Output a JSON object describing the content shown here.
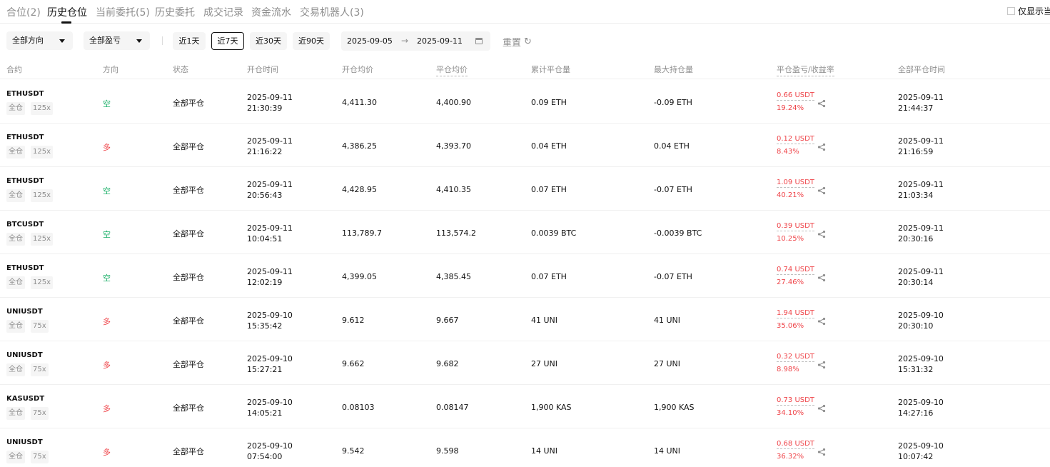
{
  "tabs": [
    {
      "label": "合位(2)"
    },
    {
      "label": "历史仓位"
    },
    {
      "label": "当前委托(5)"
    },
    {
      "label": "历史委托"
    },
    {
      "label": "成交记录"
    },
    {
      "label": "资金流水"
    },
    {
      "label": "交易机器人(3)"
    }
  ],
  "active_tab": 1,
  "only_show_label": "仅显示当",
  "filters": {
    "direction": "全部方向",
    "pnl": "全部盈亏",
    "ranges": [
      "近1天",
      "近7天",
      "近30天",
      "近90天"
    ],
    "active_range": 1,
    "date_from": "2025-09-05",
    "date_to": "2025-09-11",
    "reset_label": "重置"
  },
  "columns": [
    "合约",
    "方向",
    "状态",
    "开仓时间",
    "开仓均价",
    "平仓均价",
    "累计平仓量",
    "最大持仓量",
    "平仓盈亏/收益率",
    "全部平仓时间"
  ],
  "rows": [
    {
      "symbol": "ETHUSDT",
      "margin": "全仓",
      "leverage": "125x",
      "direction": "空",
      "dir_type": "short",
      "status": "全部平仓",
      "open_date": "2025-09-11",
      "open_clock": "21:30:39",
      "open_price": "4,411.30",
      "close_price": "4,400.90",
      "closed_qty": "0.09 ETH",
      "max_qty": "-0.09 ETH",
      "pnl": "0.66 USDT",
      "rate": "19.24%",
      "close_date": "2025-09-11",
      "close_clock": "21:44:37"
    },
    {
      "symbol": "ETHUSDT",
      "margin": "全仓",
      "leverage": "125x",
      "direction": "多",
      "dir_type": "long",
      "status": "全部平仓",
      "open_date": "2025-09-11",
      "open_clock": "21:16:22",
      "open_price": "4,386.25",
      "close_price": "4,393.70",
      "closed_qty": "0.04 ETH",
      "max_qty": "0.04 ETH",
      "pnl": "0.12 USDT",
      "rate": "8.43%",
      "close_date": "2025-09-11",
      "close_clock": "21:16:59"
    },
    {
      "symbol": "ETHUSDT",
      "margin": "全仓",
      "leverage": "125x",
      "direction": "空",
      "dir_type": "short",
      "status": "全部平仓",
      "open_date": "2025-09-11",
      "open_clock": "20:56:43",
      "open_price": "4,428.95",
      "close_price": "4,410.35",
      "closed_qty": "0.07 ETH",
      "max_qty": "-0.07 ETH",
      "pnl": "1.09 USDT",
      "rate": "40.21%",
      "close_date": "2025-09-11",
      "close_clock": "21:03:34"
    },
    {
      "symbol": "BTCUSDT",
      "margin": "全仓",
      "leverage": "125x",
      "direction": "空",
      "dir_type": "short",
      "status": "全部平仓",
      "open_date": "2025-09-11",
      "open_clock": "10:04:51",
      "open_price": "113,789.7",
      "close_price": "113,574.2",
      "closed_qty": "0.0039 BTC",
      "max_qty": "-0.0039 BTC",
      "pnl": "0.39 USDT",
      "rate": "10.25%",
      "close_date": "2025-09-11",
      "close_clock": "20:30:16"
    },
    {
      "symbol": "ETHUSDT",
      "margin": "全仓",
      "leverage": "125x",
      "direction": "空",
      "dir_type": "short",
      "status": "全部平仓",
      "open_date": "2025-09-11",
      "open_clock": "12:02:19",
      "open_price": "4,399.05",
      "close_price": "4,385.45",
      "closed_qty": "0.07 ETH",
      "max_qty": "-0.07 ETH",
      "pnl": "0.74 USDT",
      "rate": "27.46%",
      "close_date": "2025-09-11",
      "close_clock": "20:30:14"
    },
    {
      "symbol": "UNIUSDT",
      "margin": "全仓",
      "leverage": "75x",
      "direction": "多",
      "dir_type": "long",
      "status": "全部平仓",
      "open_date": "2025-09-10",
      "open_clock": "15:35:42",
      "open_price": "9.612",
      "close_price": "9.667",
      "closed_qty": "41 UNI",
      "max_qty": "41 UNI",
      "pnl": "1.94 USDT",
      "rate": "35.06%",
      "close_date": "2025-09-10",
      "close_clock": "20:30:10"
    },
    {
      "symbol": "UNIUSDT",
      "margin": "全仓",
      "leverage": "75x",
      "direction": "多",
      "dir_type": "long",
      "status": "全部平仓",
      "open_date": "2025-09-10",
      "open_clock": "15:27:21",
      "open_price": "9.662",
      "close_price": "9.682",
      "closed_qty": "27 UNI",
      "max_qty": "27 UNI",
      "pnl": "0.32 USDT",
      "rate": "8.98%",
      "close_date": "2025-09-10",
      "close_clock": "15:31:32"
    },
    {
      "symbol": "KASUSDT",
      "margin": "全仓",
      "leverage": "75x",
      "direction": "多",
      "dir_type": "long",
      "status": "全部平仓",
      "open_date": "2025-09-10",
      "open_clock": "14:05:21",
      "open_price": "0.08103",
      "close_price": "0.08147",
      "closed_qty": "1,900 KAS",
      "max_qty": "1,900 KAS",
      "pnl": "0.73 USDT",
      "rate": "34.10%",
      "close_date": "2025-09-10",
      "close_clock": "14:27:16"
    },
    {
      "symbol": "UNIUSDT",
      "margin": "全仓",
      "leverage": "75x",
      "direction": "多",
      "dir_type": "long",
      "status": "全部平仓",
      "open_date": "2025-09-10",
      "open_clock": "07:54:00",
      "open_price": "9.542",
      "close_price": "9.598",
      "closed_qty": "14 UNI",
      "max_qty": "14 UNI",
      "pnl": "0.68 USDT",
      "rate": "36.32%",
      "close_date": "2025-09-10",
      "close_clock": "10:07:42"
    }
  ]
}
